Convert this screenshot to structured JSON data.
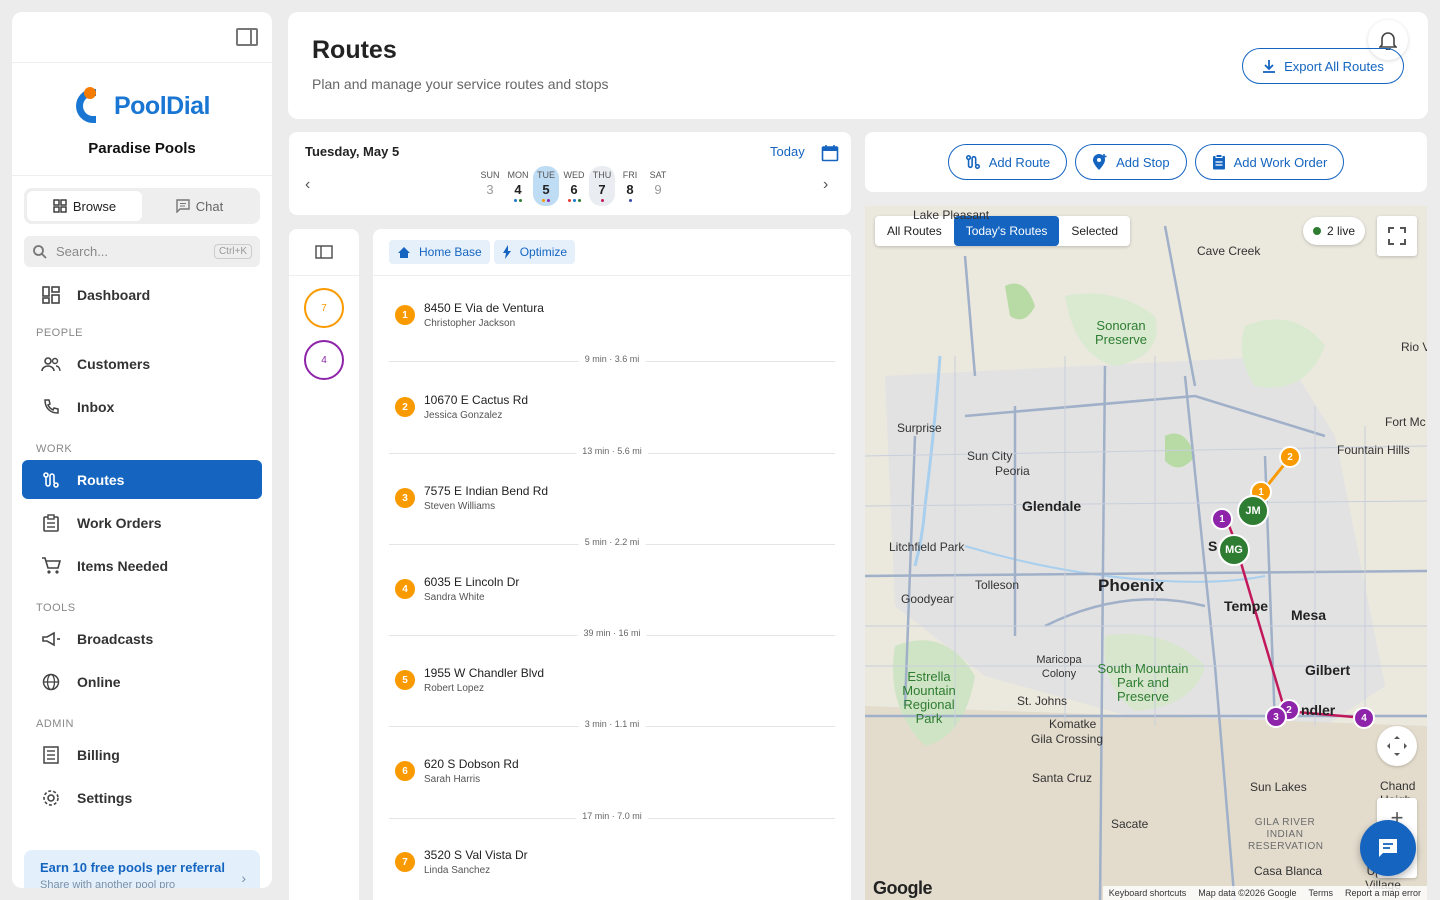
{
  "brand": {
    "logo_text": "PoolDial",
    "company": "Paradise Pools"
  },
  "sidebar": {
    "tabs": [
      {
        "label": "Browse",
        "icon": "grid-icon"
      },
      {
        "label": "Chat",
        "icon": "chat-icon"
      }
    ],
    "search": {
      "placeholder": "Search...",
      "shortcut": "Ctrl+K"
    },
    "dashboard": "Dashboard",
    "sections": {
      "people": "PEOPLE",
      "work": "WORK",
      "tools": "TOOLS",
      "admin": "ADMIN"
    },
    "items": {
      "customers": "Customers",
      "inbox": "Inbox",
      "routes": "Routes",
      "work_orders": "Work Orders",
      "items_needed": "Items Needed",
      "broadcasts": "Broadcasts",
      "online": "Online",
      "billing": "Billing",
      "settings": "Settings"
    },
    "referral": {
      "title": "Earn 10 free pools per referral",
      "subtitle": "Share with another pool pro"
    }
  },
  "header": {
    "title": "Routes",
    "subtitle": "Plan and manage your service routes and stops",
    "export_label": "Export All Routes"
  },
  "calendar": {
    "date_label": "Tuesday, May 5",
    "today_label": "Today",
    "days": [
      {
        "name": "SUN",
        "num": "3"
      },
      {
        "name": "MON",
        "num": "4"
      },
      {
        "name": "TUE",
        "num": "5"
      },
      {
        "name": "WED",
        "num": "6"
      },
      {
        "name": "THU",
        "num": "7"
      },
      {
        "name": "FRI",
        "num": "8"
      },
      {
        "name": "SAT",
        "num": "9"
      }
    ]
  },
  "actions": {
    "add_route": "Add Route",
    "add_stop": "Add Stop",
    "add_work_order": "Add Work Order"
  },
  "routes": [
    {
      "count": "7",
      "color": "#f99a00"
    },
    {
      "count": "4",
      "color": "#8e24aa"
    }
  ],
  "stops_header": {
    "home_base": "Home Base",
    "optimize": "Optimize"
  },
  "stops": [
    {
      "num": "1",
      "address": "8450 E Via de Ventura",
      "customer": "Christopher Jackson"
    },
    {
      "num": "2",
      "address": "10670 E Cactus Rd",
      "customer": "Jessica Gonzalez"
    },
    {
      "num": "3",
      "address": "7575 E Indian Bend Rd",
      "customer": "Steven Williams"
    },
    {
      "num": "4",
      "address": "6035 E Lincoln Dr",
      "customer": "Sandra White"
    },
    {
      "num": "5",
      "address": "1955 W Chandler Blvd",
      "customer": "Robert Lopez"
    },
    {
      "num": "6",
      "address": "620 S Dobson Rd",
      "customer": "Sarah Harris"
    },
    {
      "num": "7",
      "address": "3520 S Val Vista Dr",
      "customer": "Linda Sanchez"
    }
  ],
  "segments": [
    "9 min · 3.6 mi",
    "13 min · 5.6 mi",
    "5 min · 2.2 mi",
    "39 min · 16 mi",
    "3 min · 1.1 mi",
    "17 min · 7.0 mi"
  ],
  "map": {
    "tabs": [
      "All Routes",
      "Today's Routes",
      "Selected"
    ],
    "live": "2 live",
    "labels": {
      "cave_creek": "Cave Creek",
      "sonoran": "Sonoran Preserve",
      "rio_v": "Rio V",
      "surprise": "Surprise",
      "sun_city": "Sun City",
      "peoria": "Peoria",
      "fort_mc": "Fort Mc",
      "fountain_hills": "Fountain Hills",
      "glendale": "Glendale",
      "litchfield": "Litchfield Park",
      "scottsdale": "S  dale",
      "tolleson": "Tolleson",
      "phoenix": "Phoenix",
      "tempe": "Tempe",
      "mesa": "Mesa",
      "goodyear": "Goodyear",
      "maricopa_colony": "Maricopa Colony",
      "south_mountain": "South Mountain Park and Preserve",
      "gilbert": "Gilbert",
      "estrella": "Estrella Mountain Regional Park",
      "st_johns": "St. Johns",
      "chandler": "ndler",
      "komatke": "Komatke",
      "gila_crossing": "Gila Crossing",
      "santa_cruz": "Santa Cruz",
      "sun_lakes": "Sun Lakes",
      "chand_heigh": "Chand Heigh",
      "sacate": "Sacate",
      "gila_river": "GILA RIVER INDIAN RESERVATION",
      "casa_blanca": "Casa Blanca",
      "upper_village": "Upper Village",
      "lake_pleasant": "Lake Pleasant"
    },
    "markers": {
      "orange_1": "1",
      "orange_2": "2",
      "purple_1": "1",
      "purple_2": "2",
      "purple_3": "3",
      "purple_4": "4",
      "jm": "JM",
      "mg": "MG"
    },
    "google": "Google",
    "attribution": [
      "Keyboard shortcuts",
      "Map data ©2026 Google",
      "Terms",
      "Report a map error"
    ]
  }
}
